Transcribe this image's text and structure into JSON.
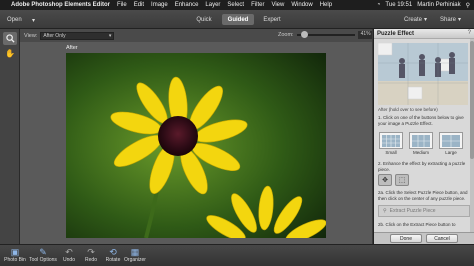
{
  "menubar": {
    "app_name": "Adobe Photoshop Elements Editor",
    "items": [
      "File",
      "Edit",
      "Image",
      "Enhance",
      "Layer",
      "Select",
      "Filter",
      "View",
      "Window",
      "Help"
    ],
    "time": "Tue 19:51",
    "user": "Martin Perhiniak"
  },
  "modebar": {
    "open_label": "Open",
    "modes": [
      "Quick",
      "Guided",
      "Expert"
    ],
    "active_mode": "Guided",
    "create_label": "Create",
    "share_label": "Share"
  },
  "viewbar": {
    "view_label": "View:",
    "view_value": "After Only",
    "zoom_label": "Zoom:",
    "zoom_value": "41%",
    "zoom_fraction": 0.08
  },
  "canvas": {
    "label": "After"
  },
  "panel": {
    "title": "Puzzle Effect",
    "preview_caption": "After (hold over to see before)",
    "step1": "1. Click on one of the buttons below to give your image a Puzzle Effect.",
    "sizes": [
      "Small",
      "Medium",
      "Large"
    ],
    "step2": "2. Enhance the effect by extracting a puzzle piece.",
    "step2a": "2a. Click the Select Puzzle Piece button, and then click on the center of any puzzle piece.",
    "extract_label": "Extract Puzzle Piece",
    "step2b": "2b. Click on the Extract Piece button to",
    "done_label": "Done",
    "cancel_label": "Cancel"
  },
  "bottombar": {
    "items": [
      "Photo Bin",
      "Tool Options",
      "Undo",
      "Redo",
      "Rotate",
      "Organizer"
    ]
  }
}
